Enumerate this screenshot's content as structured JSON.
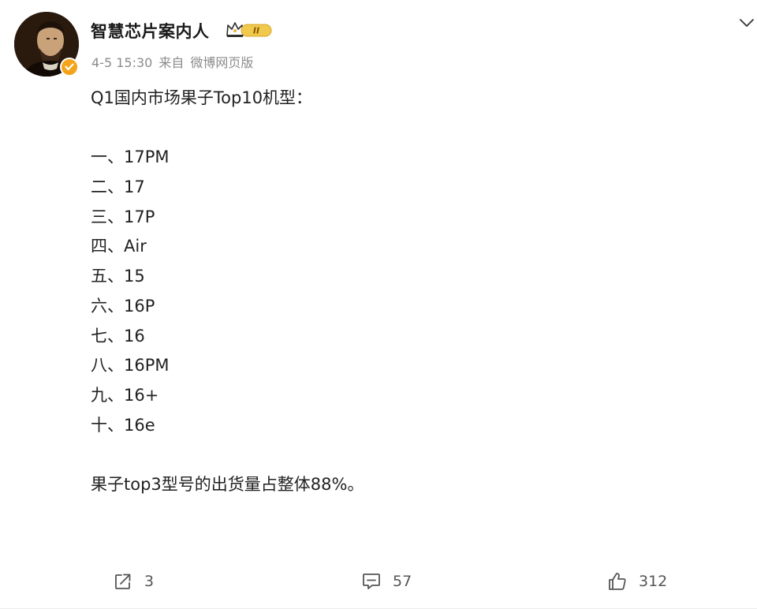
{
  "post": {
    "author": {
      "name": "智慧芯片案内人",
      "badge_label": "II"
    },
    "meta": {
      "time": "4-5 15:30",
      "from": "来自",
      "source": "微博网页版"
    },
    "content": {
      "title": "Q1国内市场果子Top10机型：",
      "ranking": [
        "一、17PM",
        "二、17",
        "三、17P",
        "四、Air",
        "五、15",
        "六、16P",
        "七、16",
        "八、16PM",
        "九、16+",
        "十、16e"
      ],
      "footer": "果子top3型号的出货量占整体88%。"
    },
    "actions": {
      "share_count": "3",
      "comment_count": "57",
      "like_count": "312"
    },
    "icons": {
      "share": "share-icon",
      "comment": "comment-icon",
      "like": "thumbs-up-icon",
      "menu": "chevron-down-icon",
      "verified": "verified-badge-icon",
      "crown": "crown-badge-icon"
    },
    "colors": {
      "verified_badge": "#f4a41a",
      "crown_gold": "#e7b43a",
      "meta_text": "#8c8c8c"
    }
  }
}
